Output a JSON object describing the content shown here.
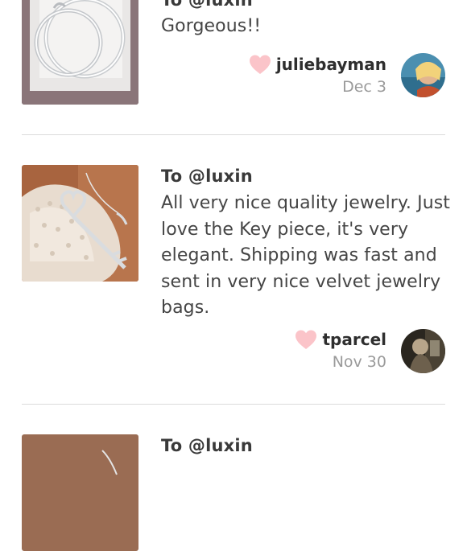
{
  "reviews": [
    {
      "to": "To @luxin",
      "comment": "Gorgeous!!",
      "username": "juliebayman",
      "date": "Dec 3",
      "thumbnail_icon": "silver-hoop-earrings-photo",
      "avatar_icon": "user-avatar-photo"
    },
    {
      "to": "To @luxin",
      "comment": "All very nice quality jewelry. Just love the Key piece, it's very elegant. Shipping was fast and sent in very nice velvet jewelry bags.",
      "username": "tparcel",
      "date": "Nov 30",
      "thumbnail_icon": "silver-key-necklace-photo",
      "avatar_icon": "user-avatar-photo"
    },
    {
      "to": "To @luxin",
      "thumbnail_icon": "jewelry-photo"
    }
  ],
  "colors": {
    "heart": "#fbc4c9",
    "divider": "#dcdcdc",
    "date_text": "#9a9a9a"
  }
}
